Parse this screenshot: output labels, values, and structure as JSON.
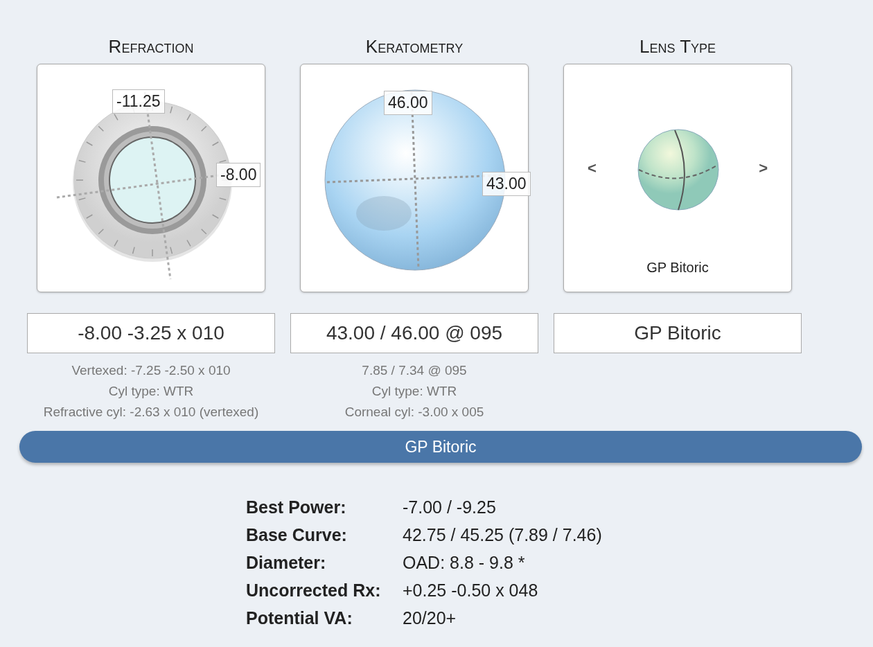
{
  "columns": [
    {
      "kind": "dial",
      "title": "Refraction",
      "readings": [
        "-11.25",
        "-8.00"
      ],
      "value": "-8.00 -3.25 x 010",
      "notes": [
        "Vertexed: -7.25 -2.50 x 010",
        "Cyl type: WTR",
        "Refractive cyl: -2.63 x 010 (vertexed)"
      ]
    },
    {
      "kind": "sphere",
      "title": "Keratometry",
      "readings": [
        "46.00",
        "43.00"
      ],
      "value": "43.00 / 46.00 @ 095",
      "notes": [
        "7.85 / 7.34 @ 095",
        "Cyl type: WTR",
        "Corneal cyl: -3.00 x 005"
      ]
    },
    {
      "kind": "lens",
      "title": "Lens Type",
      "prev": "<",
      "next": ">",
      "caption": "GP Bitoric",
      "value": "GP Bitoric"
    }
  ],
  "banner": "GP Bitoric",
  "results": [
    {
      "label": "Best Power:",
      "value": "-7.00 / -9.25"
    },
    {
      "label": "Base Curve:",
      "value": "42.75 / 45.25 (7.89 / 7.46)"
    },
    {
      "label": "Diameter:",
      "value": "OAD: 8.8 - 9.8 *"
    },
    {
      "label": "Uncorrected Rx:",
      "value": "+0.25 -0.50 x 048"
    },
    {
      "label": "Potential VA:",
      "value": "20/20+"
    }
  ]
}
